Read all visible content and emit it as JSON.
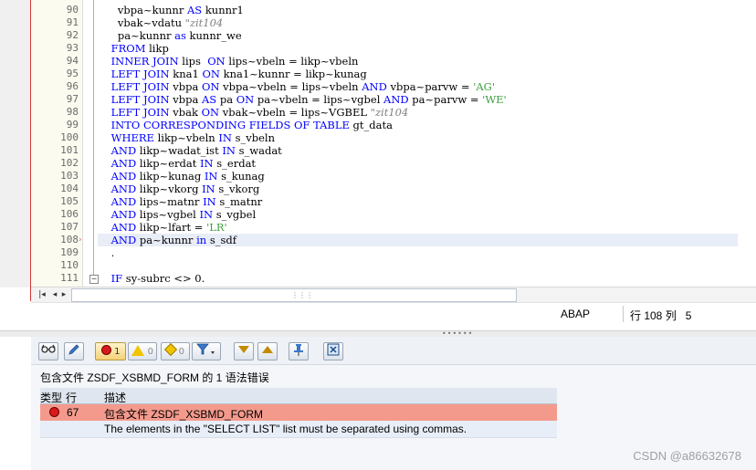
{
  "editor": {
    "line_numbers": [
      "90",
      "91",
      "92",
      "93",
      "94",
      "95",
      "96",
      "97",
      "98",
      "99",
      "100",
      "101",
      "102",
      "103",
      "104",
      "105",
      "106",
      "107",
      "108",
      "109",
      "110",
      "111"
    ],
    "lines": [
      [
        {
          "t": "      vbpa~kunnr ",
          "c": "op"
        },
        {
          "t": "AS",
          "c": "kw"
        },
        {
          "t": " kunnr1",
          "c": "op"
        }
      ],
      [
        {
          "t": "      vbak~vdatu ",
          "c": "op"
        },
        {
          "t": "\"zit104",
          "c": "cm"
        }
      ],
      [
        {
          "t": "      pa~kunnr ",
          "c": "op"
        },
        {
          "t": "as",
          "c": "kw"
        },
        {
          "t": " kunnr_we",
          "c": "op"
        }
      ],
      [
        {
          "t": "    ",
          "c": "op"
        },
        {
          "t": "FROM",
          "c": "kw"
        },
        {
          "t": " likp",
          "c": "op"
        }
      ],
      [
        {
          "t": "    ",
          "c": "op"
        },
        {
          "t": "INNER JOIN",
          "c": "kw"
        },
        {
          "t": " lips  ",
          "c": "op"
        },
        {
          "t": "ON",
          "c": "kw"
        },
        {
          "t": " lips~vbeln = likp~vbeln",
          "c": "op"
        }
      ],
      [
        {
          "t": "    ",
          "c": "op"
        },
        {
          "t": "LEFT JOIN",
          "c": "kw"
        },
        {
          "t": " kna1 ",
          "c": "op"
        },
        {
          "t": "ON",
          "c": "kw"
        },
        {
          "t": " kna1~kunnr = likp~kunag",
          "c": "op"
        }
      ],
      [
        {
          "t": "    ",
          "c": "op"
        },
        {
          "t": "LEFT JOIN",
          "c": "kw"
        },
        {
          "t": " vbpa ",
          "c": "op"
        },
        {
          "t": "ON",
          "c": "kw"
        },
        {
          "t": " vbpa~vbeln = lips~vbeln ",
          "c": "op"
        },
        {
          "t": "AND",
          "c": "kw"
        },
        {
          "t": " vbpa~parvw = ",
          "c": "op"
        },
        {
          "t": "'AG'",
          "c": "str"
        }
      ],
      [
        {
          "t": "    ",
          "c": "op"
        },
        {
          "t": "LEFT JOIN",
          "c": "kw"
        },
        {
          "t": " vbpa ",
          "c": "op"
        },
        {
          "t": "AS",
          "c": "kw"
        },
        {
          "t": " pa ",
          "c": "op"
        },
        {
          "t": "ON",
          "c": "kw"
        },
        {
          "t": " pa~vbeln = lips~vgbel ",
          "c": "op"
        },
        {
          "t": "AND",
          "c": "kw"
        },
        {
          "t": " pa~parvw = ",
          "c": "op"
        },
        {
          "t": "'WE'",
          "c": "str"
        }
      ],
      [
        {
          "t": "    ",
          "c": "op"
        },
        {
          "t": "LEFT JOIN",
          "c": "kw"
        },
        {
          "t": " vbak ",
          "c": "op"
        },
        {
          "t": "ON",
          "c": "kw"
        },
        {
          "t": " vbak~vbeln = lips~VGBEL ",
          "c": "op"
        },
        {
          "t": "\"zit104",
          "c": "cm"
        }
      ],
      [
        {
          "t": "    ",
          "c": "op"
        },
        {
          "t": "INTO CORRESPONDING FIELDS OF TABLE",
          "c": "kw"
        },
        {
          "t": " gt_data",
          "c": "op"
        }
      ],
      [
        {
          "t": "    ",
          "c": "op"
        },
        {
          "t": "WHERE",
          "c": "kw"
        },
        {
          "t": " likp~vbeln ",
          "c": "op"
        },
        {
          "t": "IN",
          "c": "kw"
        },
        {
          "t": " s_vbeln",
          "c": "op"
        }
      ],
      [
        {
          "t": "    ",
          "c": "op"
        },
        {
          "t": "AND",
          "c": "kw"
        },
        {
          "t": " likp~wadat_ist ",
          "c": "op"
        },
        {
          "t": "IN",
          "c": "kw"
        },
        {
          "t": " s_wadat",
          "c": "op"
        }
      ],
      [
        {
          "t": "    ",
          "c": "op"
        },
        {
          "t": "AND",
          "c": "kw"
        },
        {
          "t": " likp~erdat ",
          "c": "op"
        },
        {
          "t": "IN",
          "c": "kw"
        },
        {
          "t": " s_erdat",
          "c": "op"
        }
      ],
      [
        {
          "t": "    ",
          "c": "op"
        },
        {
          "t": "AND",
          "c": "kw"
        },
        {
          "t": " likp~kunag ",
          "c": "op"
        },
        {
          "t": "IN",
          "c": "kw"
        },
        {
          "t": " s_kunag",
          "c": "op"
        }
      ],
      [
        {
          "t": "    ",
          "c": "op"
        },
        {
          "t": "AND",
          "c": "kw"
        },
        {
          "t": " likp~vkorg ",
          "c": "op"
        },
        {
          "t": "IN",
          "c": "kw"
        },
        {
          "t": " s_vkorg",
          "c": "op"
        }
      ],
      [
        {
          "t": "    ",
          "c": "op"
        },
        {
          "t": "AND",
          "c": "kw"
        },
        {
          "t": " lips~matnr ",
          "c": "op"
        },
        {
          "t": "IN",
          "c": "kw"
        },
        {
          "t": " s_matnr",
          "c": "op"
        }
      ],
      [
        {
          "t": "    ",
          "c": "op"
        },
        {
          "t": "AND",
          "c": "kw"
        },
        {
          "t": " lips~vgbel ",
          "c": "op"
        },
        {
          "t": "IN",
          "c": "kw"
        },
        {
          "t": " s_vgbel",
          "c": "op"
        }
      ],
      [
        {
          "t": "    ",
          "c": "op"
        },
        {
          "t": "AND",
          "c": "kw"
        },
        {
          "t": " likp~lfart = ",
          "c": "op"
        },
        {
          "t": "'LR'",
          "c": "str"
        }
      ],
      [
        {
          "t": "    ",
          "c": "op"
        },
        {
          "t": "AND",
          "c": "kw"
        },
        {
          "t": " pa~kunnr ",
          "c": "op"
        },
        {
          "t": "in",
          "c": "kw"
        },
        {
          "t": " s_sdf",
          "c": "op"
        }
      ],
      [
        {
          "t": "    .",
          "c": "op"
        }
      ],
      [
        {
          "t": "",
          "c": "op"
        }
      ],
      [
        {
          "t": "    ",
          "c": "op"
        },
        {
          "t": "IF",
          "c": "kw"
        },
        {
          "t": " sy-subrc <> 0.",
          "c": "op"
        }
      ]
    ],
    "fold_toggle": "−"
  },
  "status": {
    "language": "ABAP",
    "position": "行 108 列   5"
  },
  "toolbar": {
    "error_count": "1",
    "warning_count": "0",
    "info_count": "0"
  },
  "errors": {
    "summary": "包含文件 ZSDF_XSBMD_FORM 的 1 语法错误",
    "col_type": "类型",
    "col_line": "行",
    "col_desc": "描述",
    "row1_line": "67",
    "row1_desc": "包含文件 ZSDF_XSBMD_FORM",
    "row2_desc": "The elements in the \"SELECT LIST\" list must be separated using commas."
  },
  "watermark": "CSDN @a86632678",
  "colors": {
    "keyword": "#0000ff",
    "string": "#40a040",
    "comment": "#808080",
    "error_row": "#f49a8c"
  }
}
